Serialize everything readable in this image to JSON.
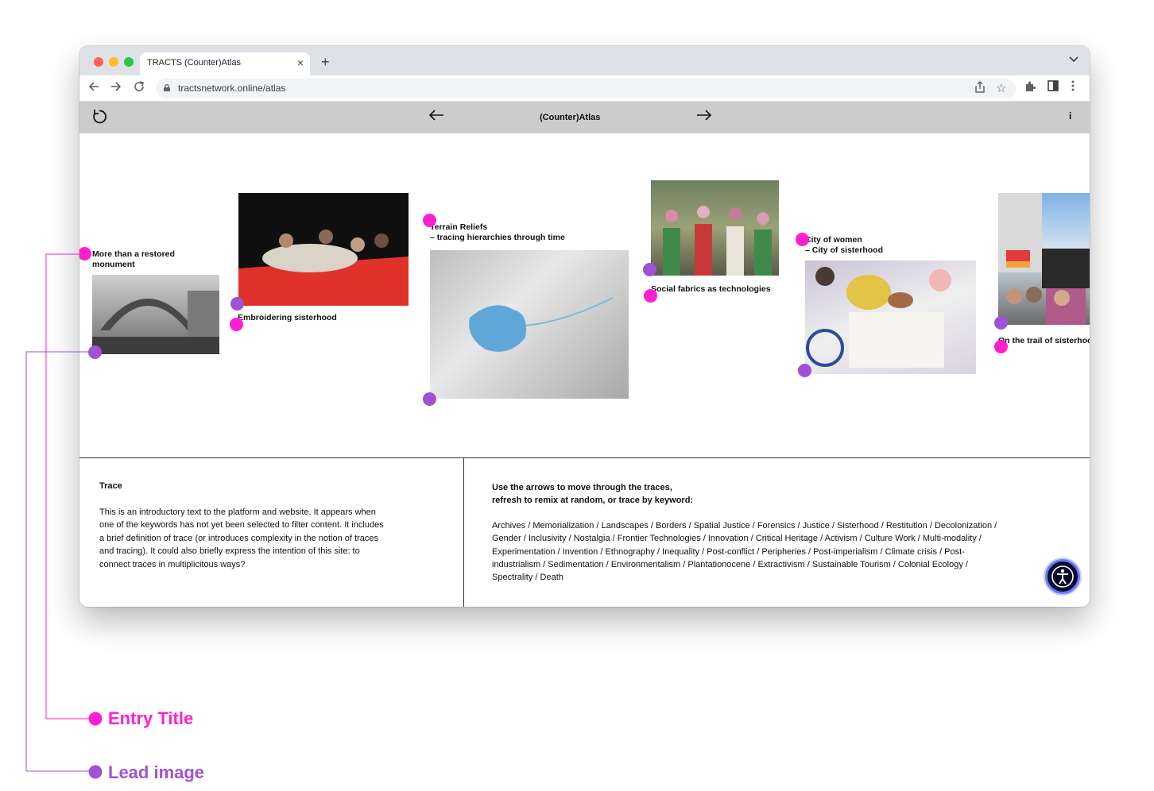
{
  "browser": {
    "tab_title": "TRACTS (Counter)Atlas",
    "close_glyph": "×",
    "new_tab_glyph": "+",
    "tab_menu_glyph": "⌄",
    "url": "tractsnetwork.online/atlas"
  },
  "site": {
    "title": "(Counter)Atlas",
    "prev_arrow": "←",
    "next_arrow": "→",
    "refresh_glyph": "↻",
    "info_glyph": "i"
  },
  "entries": [
    {
      "title": "More than a restored\nmonument"
    },
    {
      "title": "Embroidering sisterhood"
    },
    {
      "title": "Terrain Reliefs\n– tracing hierarchies through time"
    },
    {
      "title": "Social fabrics as technologies"
    },
    {
      "title": "City of women\n– City of sisterhood"
    },
    {
      "title": "On the trail of sisterhood"
    }
  ],
  "trace": {
    "heading": "Trace",
    "body": "This is an introductory text to the platform and website. It appears when one of the keywords has not yet been selected to filter content. It includes a brief definition of trace (or introduces complexity in the notion of traces and tracing). It could also briefly express the intention of this site: to connect traces in multiplicitous ways?"
  },
  "instructions": "Use the arrows to move through the traces,\nrefresh to remix at random, or trace by keyword:",
  "keywords": "Archives / Memorialization / Landscapes / Borders / Spatial Justice / Forensics / Justice / Sisterhood / Restitution / Decolonization / Gender / Inclusivity / Nostalgia / Frontier Technologies / Innovation / Critical Heritage / Activism / Culture Work / Multi-modality / Experimentation / Invention / Ethnography / Inequality / Post-conflict / Peripheries / Post-imperialism / Climate crisis / Post-industrialism / Sedimentation / Environmentalism / Plantationocene / Extractivism / Sustainable Tourism / Colonial Ecology / Spectrality / Death",
  "legend": {
    "entry_title": "Entry Title",
    "lead_image": "Lead image"
  },
  "colors": {
    "entry_title": "#ff1fd1",
    "lead_image": "#a052d4"
  }
}
